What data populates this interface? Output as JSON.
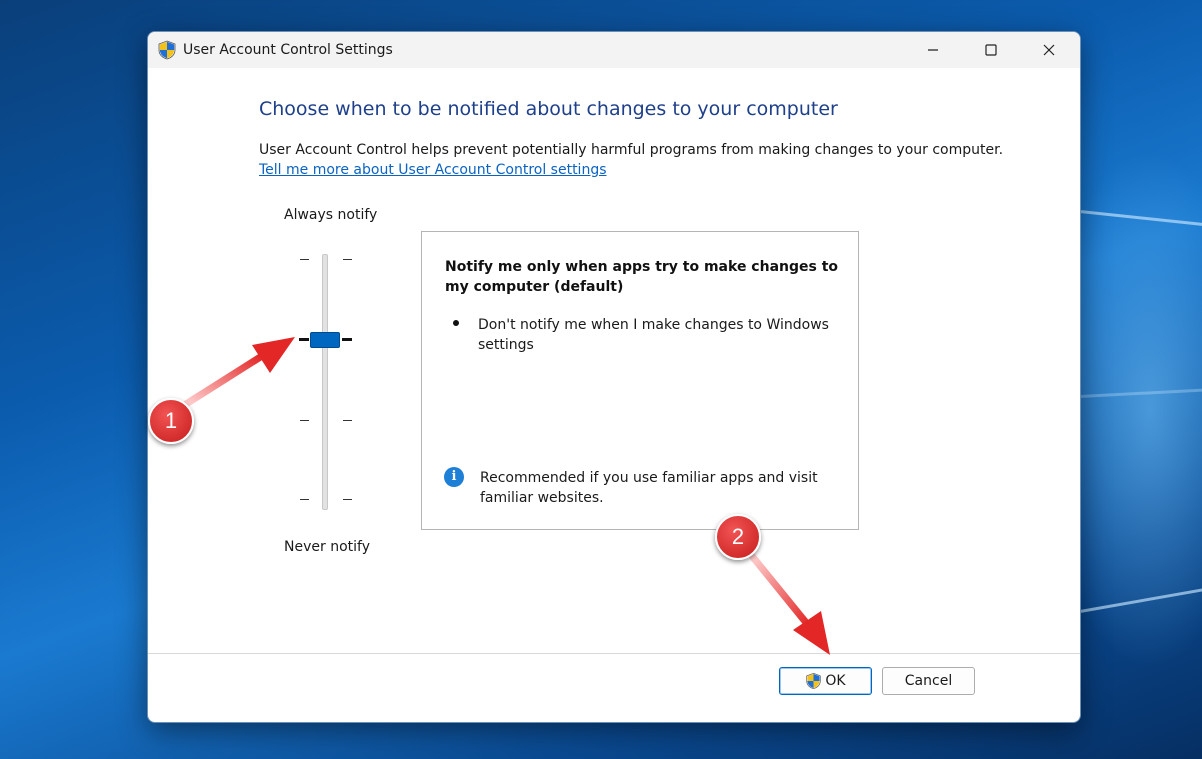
{
  "window": {
    "title": "User Account Control Settings",
    "icon": "uac-shield-icon",
    "controls": {
      "minimize": "minimize-icon",
      "maximize": "maximize-icon",
      "close": "close-icon"
    }
  },
  "main": {
    "heading": "Choose when to be notified about changes to your computer",
    "description": "User Account Control helps prevent potentially harmful programs from making changes to your computer.",
    "link": "Tell me more about User Account Control settings"
  },
  "slider": {
    "top_label": "Always notify",
    "bottom_label": "Never notify",
    "levels": 4,
    "selected_level": 2
  },
  "info": {
    "title": "Notify me only when apps try to make changes to my computer (default)",
    "bullet": "Don't notify me when I make changes to Windows settings",
    "recommendation": "Recommended if you use familiar apps and visit familiar websites."
  },
  "buttons": {
    "ok": "OK",
    "cancel": "Cancel"
  },
  "annotations": {
    "marker1": "1",
    "marker2": "2"
  },
  "colors": {
    "accent": "#0067c0",
    "heading": "#1e3f8a",
    "link": "#0b63c2",
    "annotation": "#d92b2b"
  }
}
